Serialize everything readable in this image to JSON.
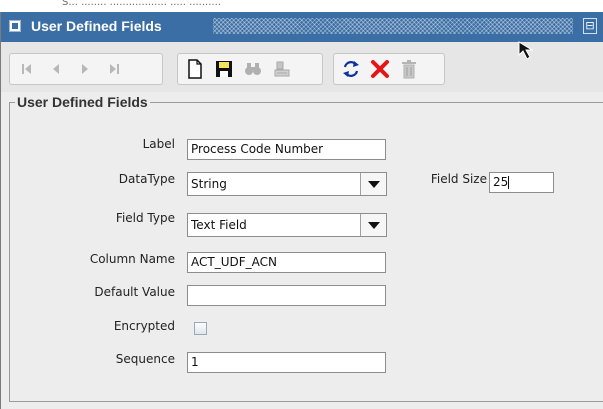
{
  "background_strip": "S... ........ .................. ..... ..........",
  "window": {
    "title": "User Defined Fields",
    "restore_glyph": "⊟"
  },
  "toolbar": {
    "nav_group": [
      "first-record-icon",
      "previous-record-icon",
      "next-record-icon",
      "last-record-icon"
    ],
    "edit_group": [
      "new-document-icon",
      "save-icon",
      "search-binoculars-icon",
      "clear-eraser-icon"
    ],
    "action_group": [
      "refresh-icon",
      "delete-x-icon",
      "trash-icon"
    ],
    "accent_red": "#e01818",
    "accent_blue": "#1030a0"
  },
  "form": {
    "section_title": "User Defined Fields",
    "label": {
      "label": "Label",
      "value": "Process Code Number"
    },
    "datatype": {
      "label": "DataType",
      "value": "String"
    },
    "field_size": {
      "label": "Field Size",
      "value": "25"
    },
    "field_type": {
      "label": "Field Type",
      "value": "Text Field"
    },
    "column_name": {
      "label": "Column Name",
      "value": "ACT_UDF_ACN"
    },
    "default_value": {
      "label": "Default Value",
      "value": ""
    },
    "encrypted": {
      "label": "Encrypted",
      "checked": false
    },
    "sequence": {
      "label": "Sequence",
      "value": "1"
    }
  }
}
